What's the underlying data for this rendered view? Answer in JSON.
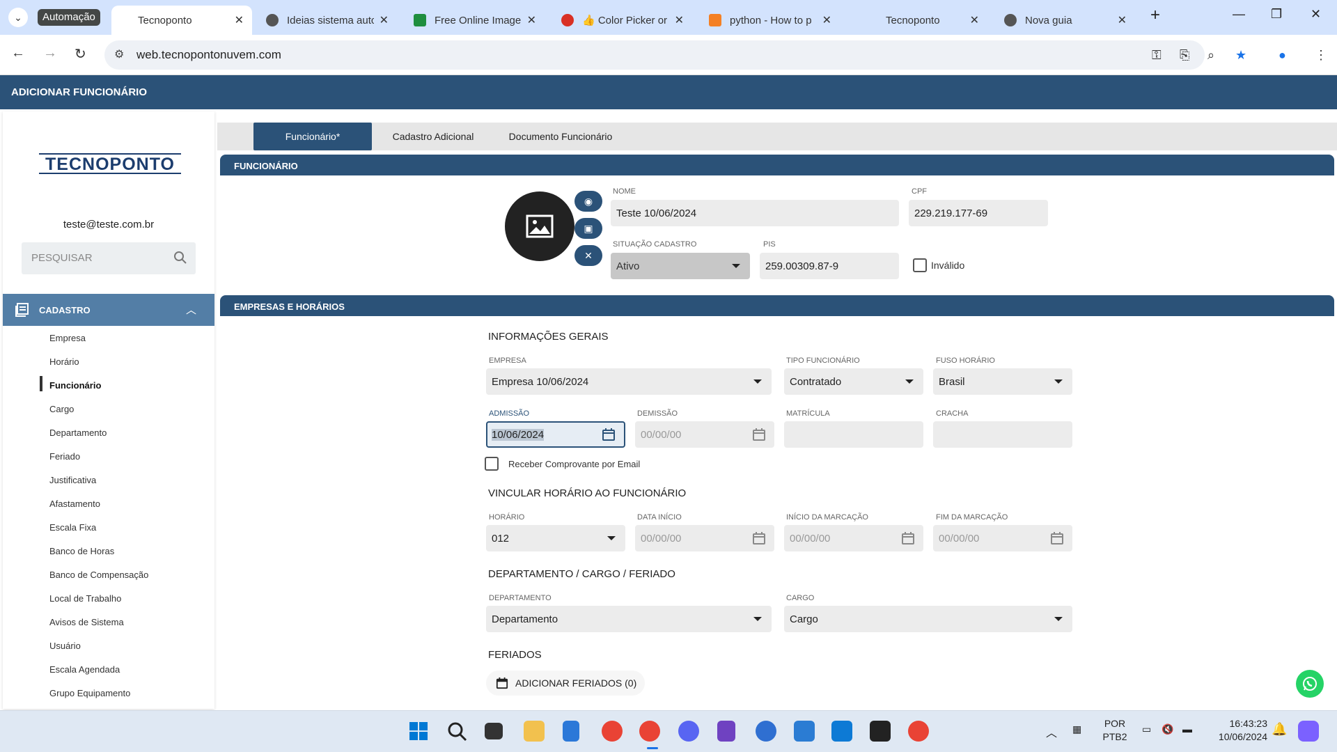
{
  "browser": {
    "tab_group_label": "Automação",
    "tabs": [
      {
        "title": "Tecnoponto",
        "active": true
      },
      {
        "title": "Ideias sistema autc"
      },
      {
        "title": "Free Online Image"
      },
      {
        "title": "👍 Color Picker or"
      },
      {
        "title": "python - How to p"
      },
      {
        "title": "Tecnoponto"
      },
      {
        "title": "Nova guia"
      }
    ],
    "url": "web.tecnopontonuvem.com"
  },
  "header": {
    "title": "ADICIONAR FUNCIONÁRIO"
  },
  "sidebar": {
    "logo_text": "TECNOPONTO",
    "user_email": "teste@teste.com.br",
    "search_placeholder": "PESQUISAR",
    "section_label": "CADASTRO",
    "items": [
      {
        "label": "Empresa"
      },
      {
        "label": "Horário"
      },
      {
        "label": "Funcionário",
        "active": true
      },
      {
        "label": "Cargo"
      },
      {
        "label": "Departamento"
      },
      {
        "label": "Feriado"
      },
      {
        "label": "Justificativa"
      },
      {
        "label": "Afastamento"
      },
      {
        "label": "Escala Fixa"
      },
      {
        "label": "Banco de Horas"
      },
      {
        "label": "Banco de Compensação"
      },
      {
        "label": "Local de Trabalho"
      },
      {
        "label": "Avisos de Sistema"
      },
      {
        "label": "Usuário"
      },
      {
        "label": "Escala Agendada"
      },
      {
        "label": "Grupo Equipamento"
      }
    ]
  },
  "page_tabs": [
    {
      "label": "Funcionário*",
      "active": true
    },
    {
      "label": "Cadastro Adicional"
    },
    {
      "label": "Documento Funcionário"
    }
  ],
  "funcionario": {
    "section_title": "FUNCIONÁRIO",
    "nome_label": "NOME",
    "nome_value": "Teste 10/06/2024",
    "cpf_label": "CPF",
    "cpf_value": "229.219.177-69",
    "situacao_label": "SITUAÇÃO CADASTRO",
    "situacao_value": "Ativo",
    "pis_label": "PIS",
    "pis_value": "259.00309.87-9",
    "invalido_label": "Inválido"
  },
  "empresas": {
    "section_title": "EMPRESAS E HORÁRIOS",
    "info_gerais": "INFORMAÇÕES GERAIS",
    "empresa_label": "EMPRESA",
    "empresa_value": "Empresa 10/06/2024",
    "tipo_label": "TIPO FUNCIONÁRIO",
    "tipo_value": "Contratado",
    "fuso_label": "FUSO HORÁRIO",
    "fuso_value": "Brasil",
    "admissao_label": "ADMISSÃO",
    "admissao_value": "10/06/2024",
    "demissao_label": "DEMISSÃO",
    "demissao_value": "00/00/00",
    "matricula_label": "MATRÍCULA",
    "matricula_value": "",
    "cracha_label": "CRACHA",
    "cracha_value": "",
    "comprovante_label": "Receber Comprovante por Email",
    "vincular_title": "VINCULAR HORÁRIO AO FUNCIONÁRIO",
    "horario_label": "HORÁRIO",
    "horario_value": "012",
    "data_inicio_label": "DATA INÍCIO",
    "data_inicio_value": "00/00/00",
    "inicio_marcacao_label": "INÍCIO DA MARCAÇÃO",
    "inicio_marcacao_value": "00/00/00",
    "fim_marcacao_label": "FIM DA MARCAÇÃO",
    "fim_marcacao_value": "00/00/00",
    "depto_title": "DEPARTAMENTO / CARGO / FERIADO",
    "departamento_label": "DEPARTAMENTO",
    "departamento_value": "Departamento",
    "cargo_label": "CARGO",
    "cargo_value": "Cargo",
    "feriados_title": "FERIADOS",
    "feriados_button": "ADICIONAR FERIADOS (0)"
  },
  "taskbar": {
    "lang_top": "POR",
    "lang_bottom": "PTB2",
    "time": "16:43:23",
    "date": "10/06/2024"
  },
  "colors": {
    "primary": "#2b5278",
    "sidebar_section": "#537ea6",
    "field_bg": "#ececec",
    "whatsapp": "#25d366"
  }
}
